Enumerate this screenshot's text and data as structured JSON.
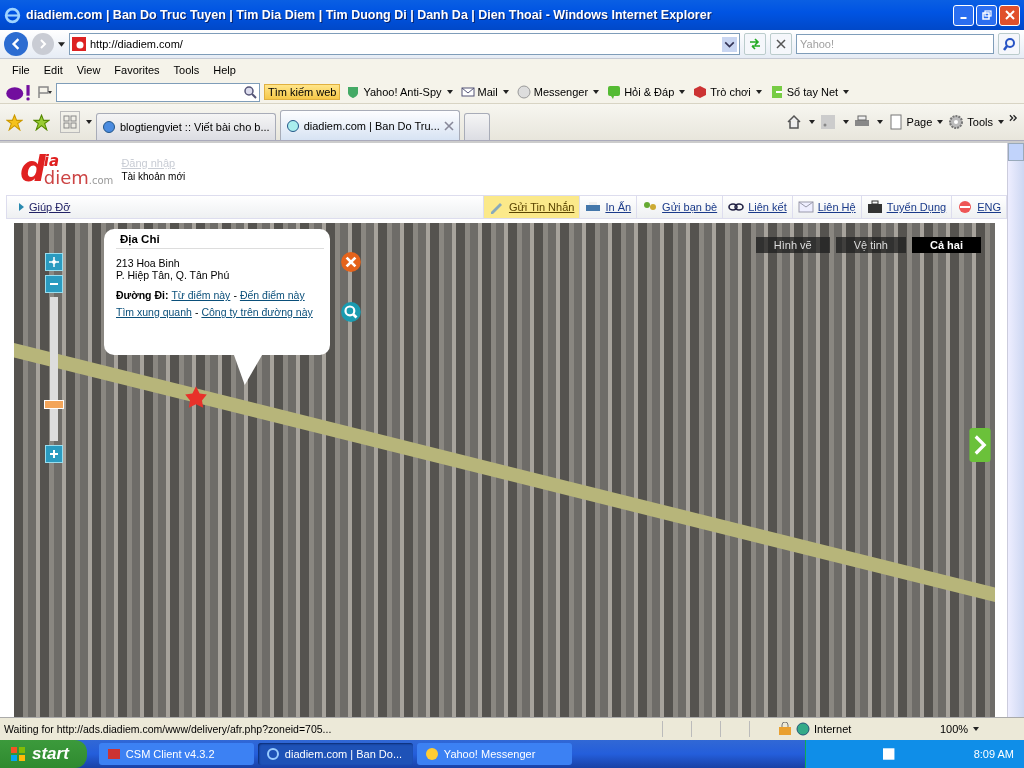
{
  "window": {
    "title": "diadiem.com | Ban Do Truc Tuyen | Tim Dia Diem | Tim Duong Di | Danh Da | Dien Thoai - Windows Internet Explorer"
  },
  "address_bar": {
    "url": "http://diadiem.com/"
  },
  "search": {
    "placeholder": "Yahoo!"
  },
  "menu": [
    "File",
    "Edit",
    "View",
    "Favorites",
    "Tools",
    "Help"
  ],
  "yahoo_toolbar": {
    "search_button": "Tìm kiếm web",
    "items": [
      "Yahoo! Anti-Spy",
      "Mail",
      "Messenger",
      "Hỏi & Đáp",
      "Trò chơi",
      "Sổ tay Net"
    ]
  },
  "tabs": [
    {
      "label": "blogtiengviet :: Viết bài cho b...",
      "selected": false
    },
    {
      "label": "diadiem.com | Ban Do Tru...",
      "selected": true
    }
  ],
  "command_bar": [
    "Page",
    "Tools"
  ],
  "page": {
    "logo": {
      "big": "d",
      "top": "ia",
      "bottom": "diem",
      "suffix": ".com"
    },
    "login": "Đăng nhập",
    "new_account": "Tài khoản mới",
    "help_link": "Giúp Đỡ",
    "nav": [
      {
        "label": "Gửi Tin Nhắn",
        "selected": true
      },
      {
        "label": "In Ấn",
        "selected": false
      },
      {
        "label": "Gửi bạn bè",
        "selected": false
      },
      {
        "label": "Liên kết",
        "selected": false
      },
      {
        "label": "Liên Hệ",
        "selected": false
      },
      {
        "label": "Tuyển Dụng",
        "selected": false
      },
      {
        "label": "ENG",
        "selected": false
      }
    ]
  },
  "map": {
    "types": [
      {
        "label": "Hình vẽ",
        "selected": false
      },
      {
        "label": "Vệ tinh",
        "selected": false
      },
      {
        "label": "Cả hai",
        "selected": true
      }
    ],
    "zoom": {
      "level": 0.22
    },
    "popup": {
      "title": "Địa Chỉ",
      "address_lines": [
        "213 Hoa Binh",
        "P. Hiệp Tân, Q. Tân Phú"
      ],
      "route_label": "Đường Đi:",
      "separator": "-",
      "route_links": [
        "Từ điểm này",
        "Đến điểm này"
      ],
      "other_links": [
        "Tìm xung quanh",
        "Công ty trên đường này"
      ]
    }
  },
  "status_bar": {
    "text": "Waiting for http://ads.diadiem.com/www/delivery/afr.php?zoneid=705...",
    "zone": "Internet",
    "zoom": "100%"
  },
  "taskbar": {
    "start": "start",
    "tasks": [
      {
        "label": "CSM Client v4.3.2",
        "selected": false
      },
      {
        "label": "diadiem.com | Ban Do...",
        "selected": true
      },
      {
        "label": "Yahoo! Messenger",
        "selected": false
      }
    ],
    "clock": "8:09 AM"
  }
}
